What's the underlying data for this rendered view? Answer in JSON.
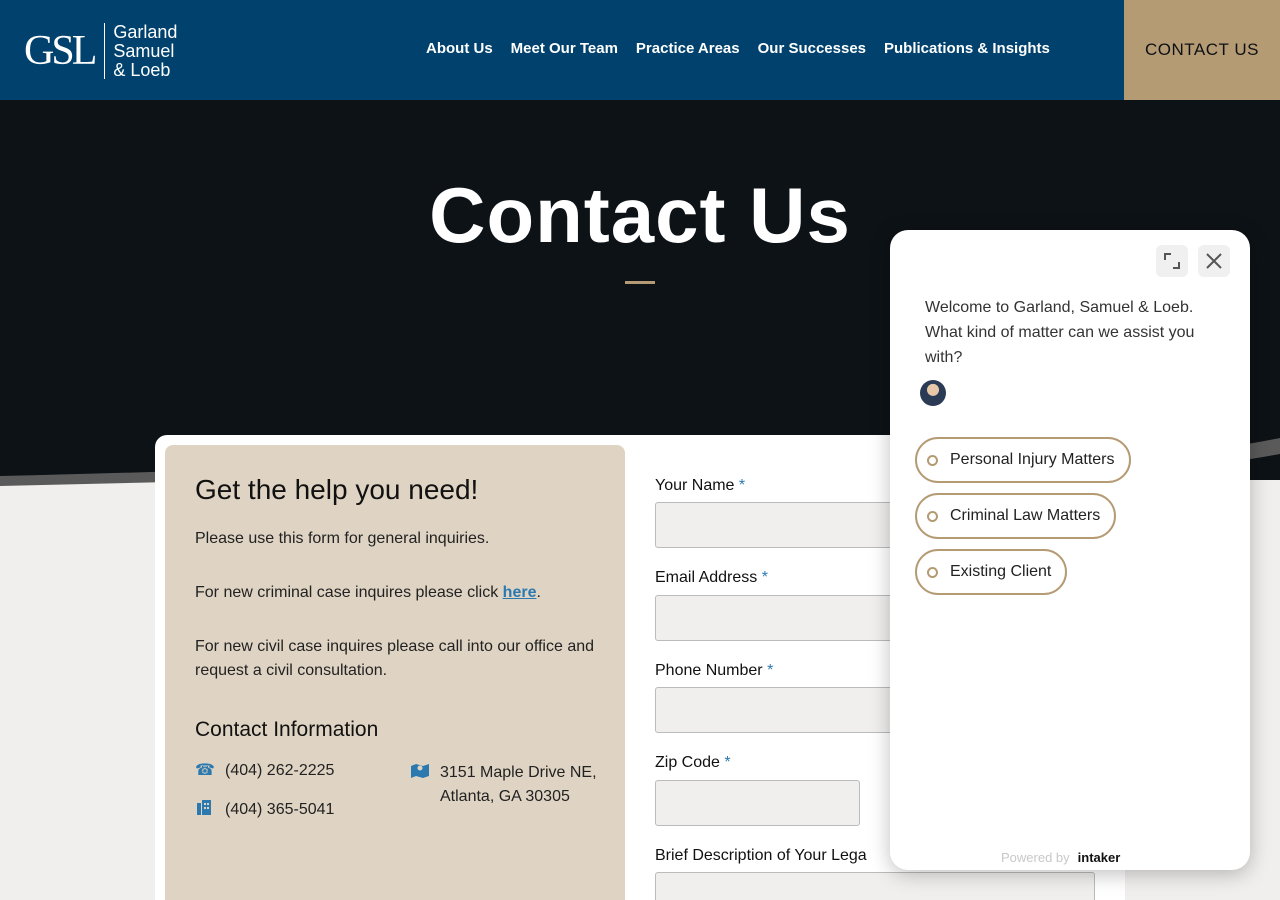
{
  "header": {
    "logo_mark": "GSL",
    "logo_lines": [
      "Garland",
      "Samuel",
      "& Loeb"
    ],
    "nav": [
      "About Us",
      "Meet Our Team",
      "Practice Areas",
      "Our Successes",
      "Publications & Insights"
    ],
    "cta": "CONTACT US",
    "colors": {
      "header_bg": "#00416e",
      "cta_bg": "#b59b74"
    }
  },
  "hero": {
    "title": "Contact Us"
  },
  "left_panel": {
    "heading": "Get the help you need!",
    "p1": "Please use this form for general inquiries.",
    "p2_prefix": "For new criminal case inquires please click ",
    "p2_link": "here",
    "p2_suffix": ".",
    "p3": "For new civil case inquires please call into our office and request a civil consultation.",
    "contact_heading": "Contact Information",
    "phone": "(404) 262-2225",
    "fax": "(404) 365-5041",
    "address_line1": "3151 Maple Drive NE,",
    "address_line2": "Atlanta, GA 30305",
    "icons": [
      "phone-icon",
      "fax-icon",
      "map-icon"
    ]
  },
  "form": {
    "name_label": "Your Name",
    "email_label": "Email Address",
    "phone_label": "Phone Number",
    "zip_label": "Zip Code",
    "description_label": "Brief Description of Your Lega",
    "required_mark": "*"
  },
  "chat": {
    "message": "Welcome to Garland, Samuel & Loeb. What kind of matter can we assist you with?",
    "options": [
      "Personal Injury Matters",
      "Criminal Law Matters",
      "Existing Client"
    ],
    "powered_by": "Powered by",
    "brand": "intaker",
    "icons": [
      "expand-icon",
      "close-icon"
    ]
  }
}
